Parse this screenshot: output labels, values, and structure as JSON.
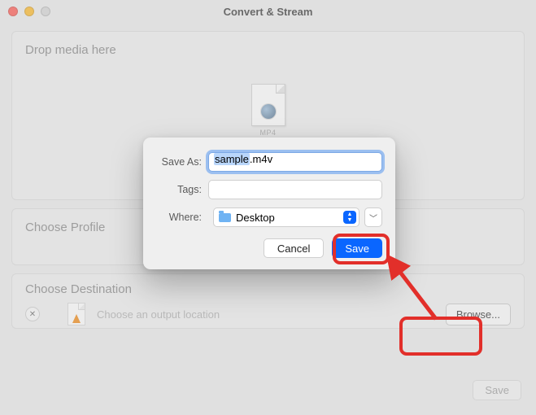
{
  "window": {
    "title": "Convert & Stream"
  },
  "dropzone": {
    "title": "Drop media here",
    "thumb_label": "MP4"
  },
  "profile": {
    "title": "Choose Profile"
  },
  "destination": {
    "title": "Choose Destination",
    "placeholder": "Choose an output location",
    "browse_label": "Browse..."
  },
  "footer": {
    "save_label": "Save"
  },
  "dialog": {
    "save_as_label": "Save As:",
    "filename_base": "sample",
    "filename_ext": ".m4v",
    "tags_label": "Tags:",
    "tags_value": "",
    "where_label": "Where:",
    "where_value": "Desktop",
    "cancel_label": "Cancel",
    "save_label": "Save"
  },
  "annotation": {
    "color": "#e22f2a"
  }
}
